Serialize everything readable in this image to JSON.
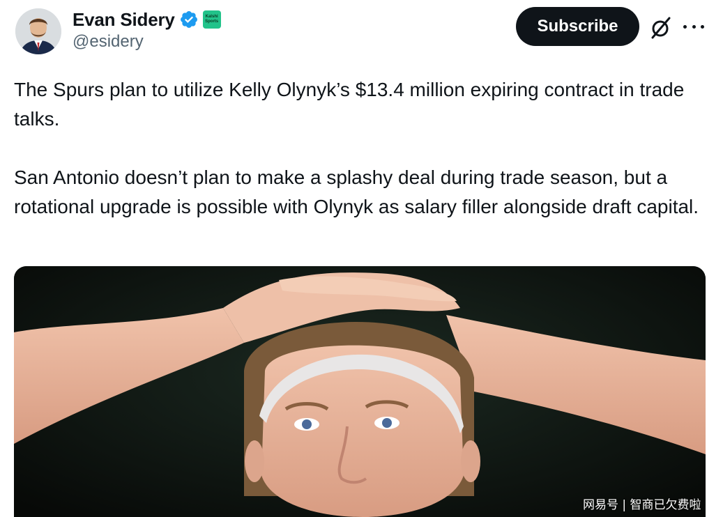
{
  "author": {
    "display_name": "Evan Sidery",
    "handle": "@esidery",
    "affiliate_badge_text": "Kalshi\nSports"
  },
  "actions": {
    "subscribe_label": "Subscribe",
    "grok_icon": "grok-icon",
    "more_icon": "more-icon"
  },
  "tweet": {
    "paragraphs": [
      "The Spurs plan to utilize Kelly Olynyk’s $13.4 million expiring contract in trade talks.",
      "San Antonio doesn’t plan to make a splashy deal during trade season, but a rotational upgrade is possible with Olynyk as salary filler alongside draft capital."
    ]
  },
  "watermark": "网易号 | 智商已欠费啦",
  "colors": {
    "verified": "#1d9bf0",
    "affiliate_badge": "#22c38a",
    "subscribe_bg": "#0f1419",
    "handle": "#536471"
  }
}
